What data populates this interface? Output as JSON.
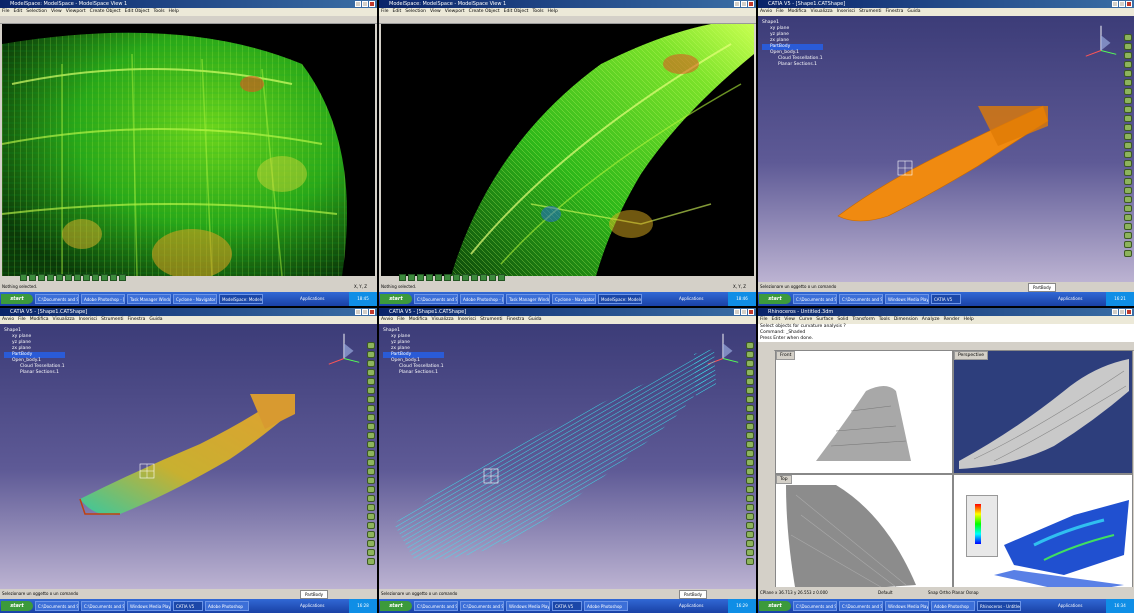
{
  "panes": {
    "p1": {
      "title": "ModelSpace: ModelSpace - ModelSpace View 1",
      "menu": [
        "File",
        "Edit",
        "Selection",
        "View",
        "Viewport",
        "Create Object",
        "Edit Object",
        "Tools",
        "Help"
      ],
      "status": "Nothing selected.",
      "coords": "X, Y, Z",
      "taskbar": {
        "start": "start",
        "tasks": [
          "C:\\Documents and Se...",
          "Adobe Photoshop - [...",
          "Task Manager Windows",
          "Cyclone - Navigator",
          "ModelSpace: Modelsp..."
        ],
        "apps": "Applications",
        "clock": "18:45"
      }
    },
    "p2": {
      "title": "ModelSpace: ModelSpace - ModelSpace View 1",
      "menu": [
        "File",
        "Edit",
        "Selection",
        "View",
        "Viewport",
        "Create Object",
        "Edit Object",
        "Tools",
        "Help"
      ],
      "status": "Nothing selected.",
      "coords": "X, Y, Z",
      "taskbar": {
        "start": "start",
        "tasks": [
          "C:\\Documents and Se...",
          "Adobe Photoshop - [...",
          "Task Manager Windows",
          "Cyclone - Navigator",
          "ModelSpace: Modelsp..."
        ],
        "apps": "Applications",
        "clock": "18:46"
      }
    },
    "p3": {
      "title": "CATIA V5 - [Shape1.CATShape]",
      "menu": [
        "Avvio",
        "File",
        "Modifica",
        "Visualizza",
        "Inserisci",
        "Strumenti",
        "Finestra",
        "Guida"
      ],
      "tree": [
        "Shape1",
        "xy plane",
        "yz plane",
        "zx plane",
        "PartBody",
        "Open_body.1",
        "Cloud Tessellation.1",
        "Planar Sections.1"
      ],
      "status": "Selezionare un oggetto o un comando",
      "combo": "PartBody",
      "taskbar": {
        "start": "start",
        "tasks": [
          "C:\\Documents and Se...",
          "C:\\Documents and Se...",
          "Windows Media Player",
          "CATIA V5"
        ],
        "apps": "Applications",
        "clock": "16:21"
      }
    },
    "p4": {
      "title": "CATIA V5 - [Shape1.CATShape]",
      "menu": [
        "Avvio",
        "File",
        "Modifica",
        "Visualizza",
        "Inserisci",
        "Strumenti",
        "Finestra",
        "Guida"
      ],
      "tree": [
        "Shape1",
        "xy plane",
        "yz plane",
        "zx plane",
        "PartBody",
        "Open_body.1",
        "Cloud Tessellation.1",
        "Planar Sections.1"
      ],
      "status": "Selezionare un oggetto o un comando",
      "combo": "PartBody",
      "taskbar": {
        "start": "start",
        "tasks": [
          "C:\\Documents and Se...",
          "C:\\Documents and Se...",
          "Windows Media Player",
          "CATIA V5",
          "Adobe Photoshop"
        ],
        "apps": "Applications",
        "clock": "16:28"
      }
    },
    "p5": {
      "title": "CATIA V5 - [Shape1.CATShape]",
      "menu": [
        "Avvio",
        "File",
        "Modifica",
        "Visualizza",
        "Inserisci",
        "Strumenti",
        "Finestra",
        "Guida"
      ],
      "tree": [
        "Shape1",
        "xy plane",
        "yz plane",
        "zx plane",
        "PartBody",
        "Open_body.1",
        "Cloud Tessellation.1",
        "Planar Sections.1"
      ],
      "status": "Selezionare un oggetto o un comando",
      "combo": "PartBody",
      "taskbar": {
        "start": "start",
        "tasks": [
          "C:\\Documents and Se...",
          "C:\\Documents and Se...",
          "Windows Media Player",
          "CATIA V5",
          "Adobe Photoshop"
        ],
        "apps": "Applications",
        "clock": "16:29"
      }
    },
    "p6": {
      "title": "Rhinoceros - Untitled.3dm",
      "menu": [
        "File",
        "Edit",
        "View",
        "Curve",
        "Surface",
        "Solid",
        "Transform",
        "Tools",
        "Dimension",
        "Analyze",
        "Render",
        "Help"
      ],
      "command_lines": [
        "Select objects for curvature analysis ?",
        "Command: _Shaded",
        "Press Enter when done."
      ],
      "viewports": [
        "Front",
        "Perspective",
        "Top",
        ""
      ],
      "status": "CPlane  x 36.713  y 26.553  z 0.000",
      "layer": "Default",
      "osnap": "Snap  Ortho  Planar  Osnap",
      "taskbar": {
        "start": "start",
        "tasks": [
          "C:\\Documents and Se...",
          "C:\\Documents and Se...",
          "Windows Media Player",
          "Adobe Photoshop",
          "Rhinoceros - Untitled"
        ],
        "apps": "Applications",
        "clock": "16:34"
      }
    }
  }
}
